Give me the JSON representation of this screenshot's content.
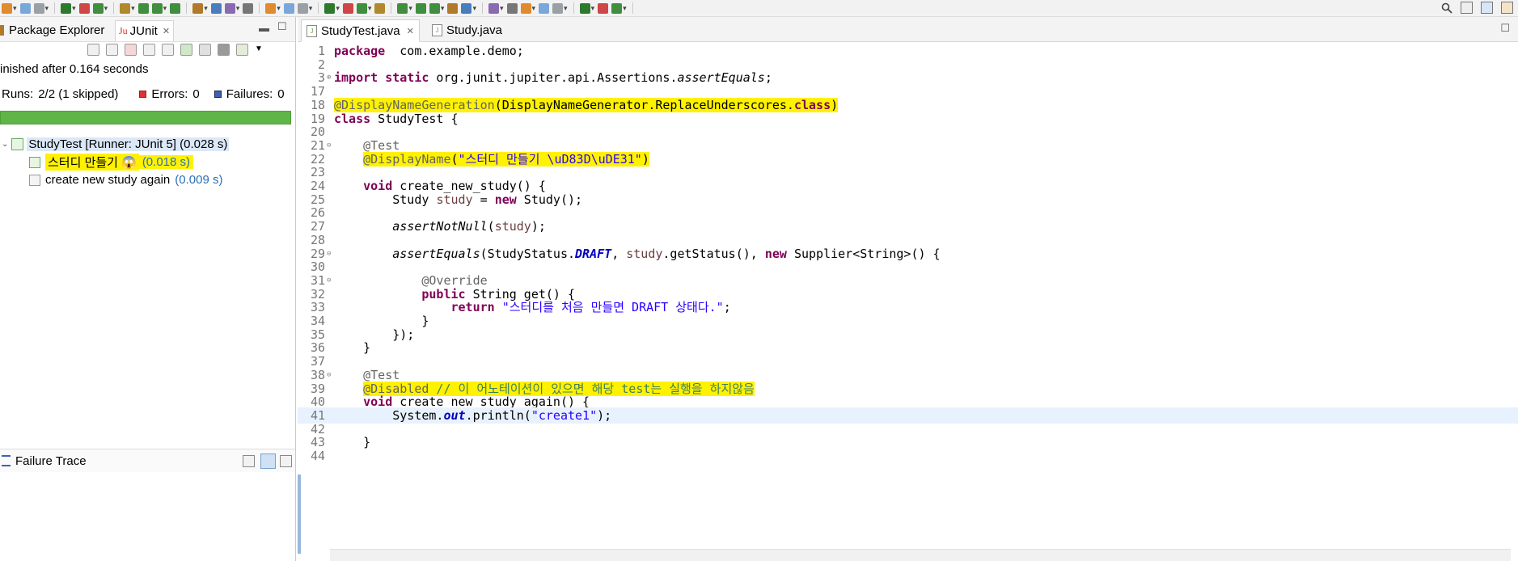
{
  "toolbar": {
    "colors": [
      "#e08b2e",
      "#7aa7d9",
      "#9aa0a6",
      "#2d7a2d",
      "#d04545",
      "#3f8f3f",
      "#b0892d",
      "#3f8f3f",
      "#3f8f3f",
      "#3f8f3f",
      "#b07a2a",
      "#4a7dbb",
      "#8a6bb3",
      "#777777"
    ],
    "search_icon": "search-icon"
  },
  "left_panel": {
    "tabs": {
      "package_explorer": "Package Explorer",
      "junit": "JUnit"
    },
    "finished_text": "inished after 0.164 seconds",
    "runs_label": "Runs:",
    "runs_value": "2/2 (1 skipped)",
    "errors_label": "Errors:",
    "errors_value": "0",
    "failures_label": "Failures:",
    "failures_value": "0",
    "progress_color": "#5fb548",
    "tree": {
      "root": "StudyTest [Runner: JUnit 5] (0.028 s)",
      "child1_label": "스터디 만들기 😱",
      "child1_time": "(0.018 s)",
      "child2_label": "create new study again",
      "child2_time": "(0.009 s)"
    },
    "failure_trace_title": "Failure Trace"
  },
  "editor": {
    "tabs": {
      "active": "StudyTest.java",
      "other": "Study.java"
    },
    "lines": [
      {
        "n": "1",
        "parts": [
          [
            "kw",
            "package"
          ],
          [
            "",
            "  com.example.demo;"
          ]
        ]
      },
      {
        "n": "2",
        "parts": []
      },
      {
        "n": "3",
        "fold": "⊕",
        "parts": [
          [
            "kw",
            "import"
          ],
          [
            "",
            " "
          ],
          [
            "kw",
            "static"
          ],
          [
            "",
            " org.junit.jupiter.api.Assertions."
          ],
          [
            "sm",
            "assertEquals"
          ],
          [
            "",
            ";"
          ]
        ]
      },
      {
        "n": "17",
        "parts": []
      },
      {
        "n": "18",
        "parts": [
          [
            "ann hlc",
            "@DisplayNameGeneration"
          ],
          [
            "hlc",
            "(DisplayNameGenerator.ReplaceUnderscores."
          ],
          [
            "kw hlc",
            "class"
          ],
          [
            "hlc",
            ")"
          ]
        ]
      },
      {
        "n": "19",
        "parts": [
          [
            "kw",
            "class"
          ],
          [
            "",
            " StudyTest {"
          ]
        ]
      },
      {
        "n": "20",
        "parts": []
      },
      {
        "n": "21",
        "fold": "⊖",
        "parts": [
          [
            "",
            "    "
          ],
          [
            "ann",
            "@Test"
          ]
        ]
      },
      {
        "n": "22",
        "parts": [
          [
            "",
            "    "
          ],
          [
            "ann hlc",
            "@DisplayName"
          ],
          [
            "hlc",
            "("
          ],
          [
            "str hlc",
            "\"스터디 만들기 \\uD83D\\uDE31\""
          ],
          [
            "hlc",
            ")"
          ]
        ]
      },
      {
        "n": "23",
        "parts": []
      },
      {
        "n": "24",
        "parts": [
          [
            "",
            "    "
          ],
          [
            "kw",
            "void"
          ],
          [
            "",
            " create_new_study() {"
          ]
        ]
      },
      {
        "n": "25",
        "parts": [
          [
            "",
            "        Study "
          ],
          [
            "var",
            "study"
          ],
          [
            "",
            " = "
          ],
          [
            "kw",
            "new"
          ],
          [
            "",
            " Study();"
          ]
        ]
      },
      {
        "n": "26",
        "parts": []
      },
      {
        "n": "27",
        "parts": [
          [
            "",
            "        "
          ],
          [
            "sm",
            "assertNotNull"
          ],
          [
            "",
            "("
          ],
          [
            "var",
            "study"
          ],
          [
            "",
            ");"
          ]
        ]
      },
      {
        "n": "28",
        "parts": []
      },
      {
        "n": "29",
        "fold": "⊖",
        "parts": [
          [
            "",
            "        "
          ],
          [
            "sm",
            "assertEquals"
          ],
          [
            "",
            "(StudyStatus."
          ],
          [
            "fld",
            "DRAFT"
          ],
          [
            "",
            ", "
          ],
          [
            "var",
            "study"
          ],
          [
            "",
            ".getStatus(), "
          ],
          [
            "kw",
            "new"
          ],
          [
            "",
            " Supplier<String>() {"
          ]
        ]
      },
      {
        "n": "30",
        "parts": []
      },
      {
        "n": "31",
        "fold": "⊖",
        "parts": [
          [
            "",
            "            "
          ],
          [
            "ann",
            "@Override"
          ]
        ]
      },
      {
        "n": "32",
        "parts": [
          [
            "",
            "            "
          ],
          [
            "kw",
            "public"
          ],
          [
            "",
            " String get() {"
          ]
        ]
      },
      {
        "n": "33",
        "parts": [
          [
            "",
            "                "
          ],
          [
            "kw",
            "return"
          ],
          [
            "",
            " "
          ],
          [
            "str",
            "\"스터디를 처음 만들면 DRAFT 상태다.\""
          ],
          [
            "",
            ";"
          ]
        ]
      },
      {
        "n": "34",
        "parts": [
          [
            "",
            "            }"
          ]
        ]
      },
      {
        "n": "35",
        "parts": [
          [
            "",
            "        });"
          ]
        ]
      },
      {
        "n": "36",
        "parts": [
          [
            "",
            "    }"
          ]
        ]
      },
      {
        "n": "37",
        "parts": []
      },
      {
        "n": "38",
        "fold": "⊖",
        "parts": [
          [
            "",
            "    "
          ],
          [
            "ann",
            "@Test"
          ]
        ]
      },
      {
        "n": "39",
        "parts": [
          [
            "",
            "    "
          ],
          [
            "ann hlc",
            "@Disabled"
          ],
          [
            "cm hlc",
            " // 이 어노테이션이 있으면 해당 test는 실행을 하지않음"
          ]
        ]
      },
      {
        "n": "40",
        "parts": [
          [
            "",
            "    "
          ],
          [
            "kw",
            "void"
          ],
          [
            "",
            " create_new_study_again() {"
          ]
        ]
      },
      {
        "n": "41",
        "current": true,
        "parts": [
          [
            "",
            "        System."
          ],
          [
            "fld",
            "out"
          ],
          [
            "",
            ".println("
          ],
          [
            "str",
            "\"create1\""
          ],
          [
            "",
            ");"
          ]
        ]
      },
      {
        "n": "42",
        "parts": []
      },
      {
        "n": "43",
        "parts": [
          [
            "",
            "    }"
          ]
        ]
      },
      {
        "n": "44",
        "parts": []
      }
    ]
  }
}
